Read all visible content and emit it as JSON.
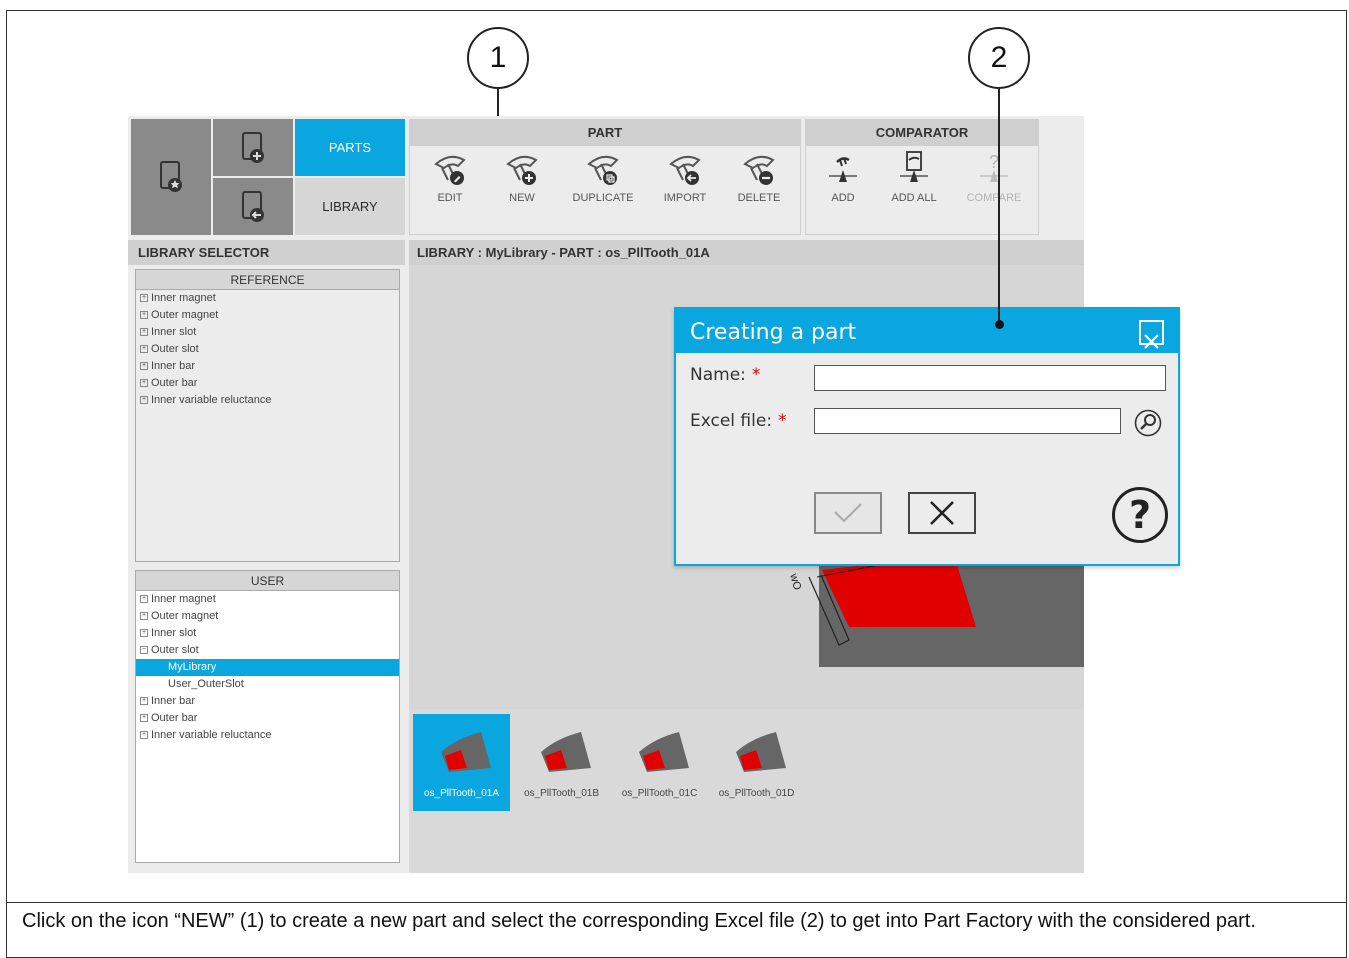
{
  "callouts": {
    "one": "1",
    "two": "2"
  },
  "caption": "Click on the icon “NEW” (1) to create a new part and select the corresponding Excel file (2) to get into Part Factory with the considered part.",
  "nav": {
    "parts": "PARTS",
    "library": "LIBRARY"
  },
  "toolbar": {
    "part_header": "PART",
    "edit": "EDIT",
    "new": "NEW",
    "duplicate": "DUPLICATE",
    "import": "IMPORT",
    "delete": "DELETE",
    "comparator_header": "COMPARATOR",
    "add": "ADD",
    "add_all": "ADD ALL",
    "compare": "COMPARE"
  },
  "library_selector": {
    "title": "LIBRARY SELECTOR",
    "reference_header": "REFERENCE",
    "reference_items": [
      "Inner magnet",
      "Outer magnet",
      "Inner slot",
      "Outer slot",
      "Inner bar",
      "Outer bar",
      "Inner variable reluctance"
    ],
    "user_header": "USER",
    "user_items": [
      "Inner magnet",
      "Outer magnet",
      "Inner slot",
      "Outer slot",
      "MyLibrary",
      "User_OuterSlot",
      "Inner bar",
      "Outer bar",
      "Inner variable reluctance"
    ]
  },
  "breadcrumb": "LIBRARY : MyLibrary   -   PART : os_PllTooth_01A",
  "view": {
    "dim_label": "wO"
  },
  "thumbnails": [
    "os_PllTooth_01A",
    "os_PllTooth_01B",
    "os_PllTooth_01C",
    "os_PllTooth_01D"
  ],
  "dialog": {
    "title": "Creating a part",
    "name_label": "Name:",
    "excel_label": "Excel file:",
    "required_mark": "*",
    "name_value": "",
    "excel_value": "",
    "help": "?"
  },
  "colors": {
    "accent": "#0aa6df",
    "tooth_red": "#e00000",
    "shape_gray": "#666666"
  }
}
